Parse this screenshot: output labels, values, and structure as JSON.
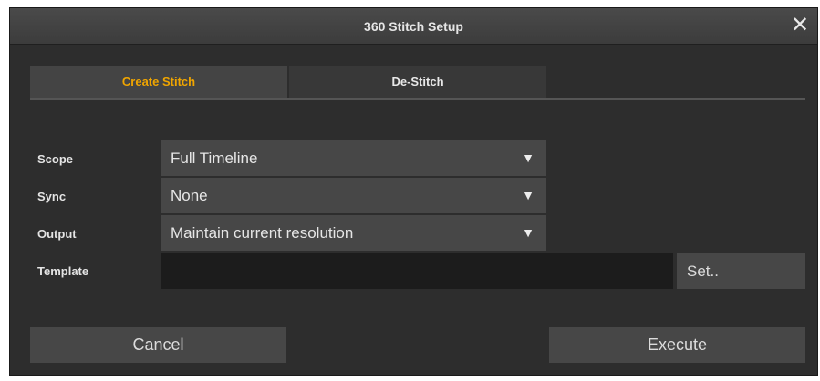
{
  "dialog": {
    "title": "360 Stitch Setup",
    "close_glyph": "✕"
  },
  "tabs": [
    {
      "label": "Create Stitch",
      "active": true
    },
    {
      "label": "De-Stitch",
      "active": false
    }
  ],
  "form": {
    "scope": {
      "label": "Scope",
      "value": "Full Timeline"
    },
    "sync": {
      "label": "Sync",
      "value": "None"
    },
    "output": {
      "label": "Output",
      "value": "Maintain current resolution"
    },
    "template": {
      "label": "Template",
      "value": "",
      "set_label": "Set.."
    }
  },
  "dropdown_arrow": "▼",
  "buttons": {
    "cancel": "Cancel",
    "execute": "Execute"
  },
  "colors": {
    "dialog_bg": "#2d2d2d",
    "active_tab_text": "#f0a500",
    "control_bg": "#474747",
    "text_field_bg": "#1c1c1c"
  },
  "icons": {
    "close": "close-icon",
    "dropdown": "chevron-down-icon"
  }
}
